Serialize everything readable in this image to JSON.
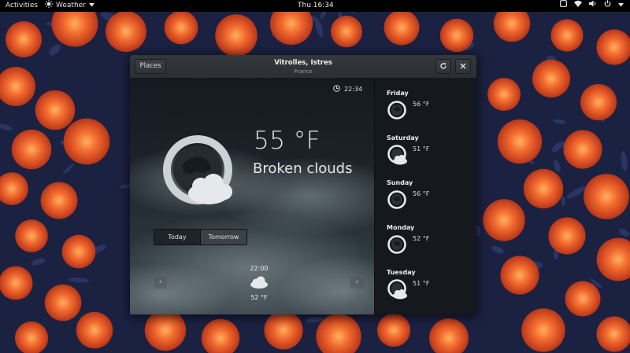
{
  "topbar": {
    "activities": "Activities",
    "app_name": "Weather",
    "clock": "Thu 16:34"
  },
  "window": {
    "places_button": "Places",
    "title": "Vitrolles, Istres",
    "subtitle": "France",
    "refresh_icon": "refresh-icon",
    "close_icon": "close-icon"
  },
  "current": {
    "time": "22:34",
    "temperature": "55 °F",
    "condition": "Broken clouds",
    "icon": "broken-clouds-night-icon"
  },
  "tabs": [
    "Today",
    "Tomorrow"
  ],
  "hourly": {
    "time": "22:00",
    "icon": "cloud-icon",
    "temperature": "52 °F"
  },
  "forecast": [
    {
      "day": "Friday",
      "temp": "56 °F",
      "icon": "clear-night-icon"
    },
    {
      "day": "Saturday",
      "temp": "51 °F",
      "icon": "few-clouds-night-icon"
    },
    {
      "day": "Sunday",
      "temp": "56 °F",
      "icon": "clear-night-icon"
    },
    {
      "day": "Monday",
      "temp": "52 °F",
      "icon": "clear-night-icon"
    },
    {
      "day": "Tuesday",
      "temp": "51 °F",
      "icon": "few-clouds-night-icon"
    }
  ],
  "colors": {
    "topbar": "#000000",
    "window_bg": "#1d2126",
    "sidebar_bg": "#15191d",
    "wallpaper_flower": "#f0622c",
    "wallpaper_leaf": "#26305a"
  }
}
